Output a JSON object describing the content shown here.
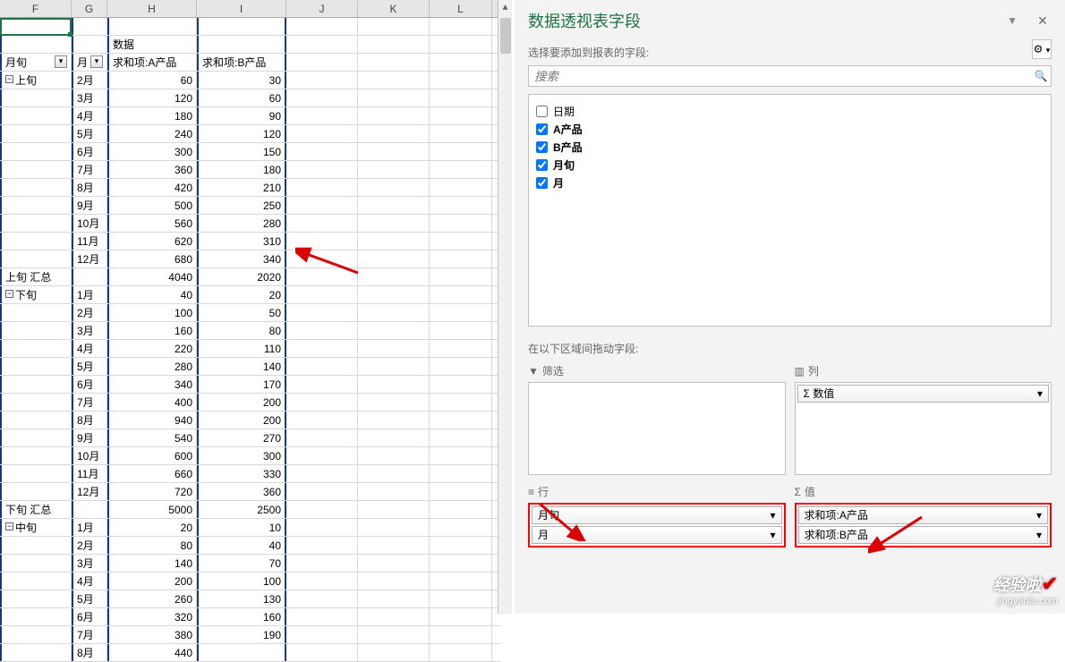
{
  "columns": [
    "F",
    "G",
    "H",
    "I",
    "J",
    "K",
    "L"
  ],
  "header_data_label": "数据",
  "header_row": {
    "f": "月旬",
    "g": "月",
    "h": "求和项:A产品",
    "i": "求和项:B产品"
  },
  "groups": [
    {
      "name": "上旬",
      "rows": [
        {
          "m": "2月",
          "a": 60,
          "b": 30
        },
        {
          "m": "3月",
          "a": 120,
          "b": 60
        },
        {
          "m": "4月",
          "a": 180,
          "b": 90
        },
        {
          "m": "5月",
          "a": 240,
          "b": 120
        },
        {
          "m": "6月",
          "a": 300,
          "b": 150
        },
        {
          "m": "7月",
          "a": 360,
          "b": 180
        },
        {
          "m": "8月",
          "a": 420,
          "b": 210
        },
        {
          "m": "9月",
          "a": 500,
          "b": 250
        },
        {
          "m": "10月",
          "a": 560,
          "b": 280
        },
        {
          "m": "11月",
          "a": 620,
          "b": 310
        },
        {
          "m": "12月",
          "a": 680,
          "b": 340
        }
      ],
      "total_label": "上旬 汇总",
      "total_a": 4040,
      "total_b": 2020
    },
    {
      "name": "下旬",
      "rows": [
        {
          "m": "1月",
          "a": 40,
          "b": 20
        },
        {
          "m": "2月",
          "a": 100,
          "b": 50
        },
        {
          "m": "3月",
          "a": 160,
          "b": 80
        },
        {
          "m": "4月",
          "a": 220,
          "b": 110
        },
        {
          "m": "5月",
          "a": 280,
          "b": 140
        },
        {
          "m": "6月",
          "a": 340,
          "b": 170
        },
        {
          "m": "7月",
          "a": 400,
          "b": 200
        },
        {
          "m": "8月",
          "a": 940,
          "b": 200
        },
        {
          "m": "9月",
          "a": 540,
          "b": 270
        },
        {
          "m": "10月",
          "a": 600,
          "b": 300
        },
        {
          "m": "11月",
          "a": 660,
          "b": 330
        },
        {
          "m": "12月",
          "a": 720,
          "b": 360
        }
      ],
      "total_label": "下旬 汇总",
      "total_a": 5000,
      "total_b": 2500
    },
    {
      "name": "中旬",
      "rows": [
        {
          "m": "1月",
          "a": 20,
          "b": 10
        },
        {
          "m": "2月",
          "a": 80,
          "b": 40
        },
        {
          "m": "3月",
          "a": 140,
          "b": 70
        },
        {
          "m": "4月",
          "a": 200,
          "b": 100
        },
        {
          "m": "5月",
          "a": 260,
          "b": 130
        },
        {
          "m": "6月",
          "a": 320,
          "b": 160
        },
        {
          "m": "7月",
          "a": 380,
          "b": 190
        },
        {
          "m": "8月",
          "a": 440,
          "b": null
        }
      ]
    }
  ],
  "panel": {
    "title": "数据透视表字段",
    "subtitle": "选择要添加到报表的字段:",
    "search_placeholder": "搜索",
    "fields": [
      {
        "label": "日期",
        "checked": false
      },
      {
        "label": "A产品",
        "checked": true
      },
      {
        "label": "B产品",
        "checked": true
      },
      {
        "label": "月旬",
        "checked": true
      },
      {
        "label": "月",
        "checked": true
      }
    ],
    "drag_label": "在以下区域间拖动字段:",
    "areas": {
      "filter": {
        "title": "筛选",
        "items": []
      },
      "columns": {
        "title": "列",
        "items": [
          "数值"
        ]
      },
      "rows": {
        "title": "行",
        "items": [
          "月旬",
          "月"
        ]
      },
      "values": {
        "title": "值",
        "items": [
          "求和项:A产品",
          "求和项:B产品"
        ]
      }
    },
    "sigma": "Σ"
  },
  "watermark": {
    "line1": "经验啦",
    "line2": "jingyanla.com"
  }
}
